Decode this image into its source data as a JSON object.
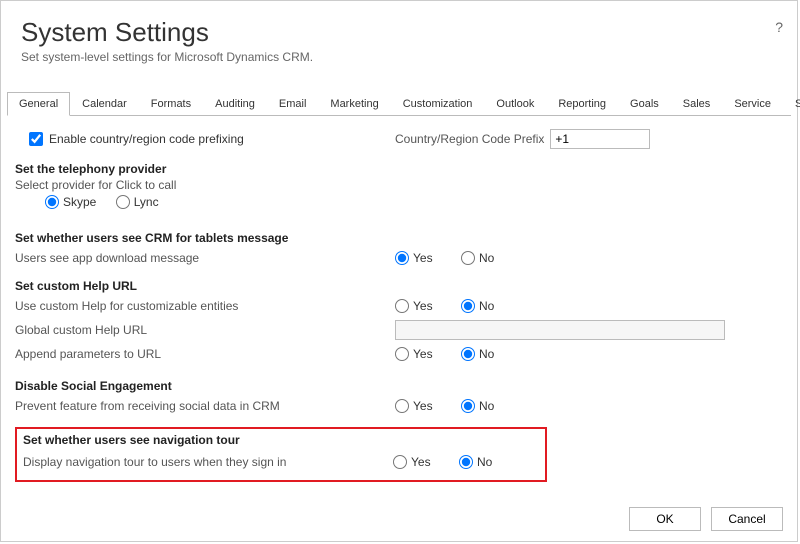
{
  "header": {
    "title": "System Settings",
    "subtitle": "Set system-level settings for Microsoft Dynamics CRM.",
    "help": "?"
  },
  "tabs": [
    "General",
    "Calendar",
    "Formats",
    "Auditing",
    "Email",
    "Marketing",
    "Customization",
    "Outlook",
    "Reporting",
    "Goals",
    "Sales",
    "Service",
    "Synchronization"
  ],
  "activeTab": "General",
  "enablePrefix": {
    "label": "Enable country/region code prefixing",
    "checked": true
  },
  "countryPrefix": {
    "label": "Country/Region Code Prefix",
    "value": "+1"
  },
  "yes": "Yes",
  "no": "No",
  "sections": {
    "telephony": {
      "title": "Set the telephony provider",
      "sub": "Select provider for Click to call",
      "options": [
        "Skype",
        "Lync"
      ],
      "selected": "Skype"
    },
    "tablets": {
      "title": "Set whether users see CRM for tablets message",
      "sub": "Users see app download message",
      "selected": "Yes"
    },
    "helpurl": {
      "title": "Set custom Help URL",
      "row1": "Use custom Help for customizable entities",
      "row1_selected": "No",
      "row2": "Global custom Help URL",
      "row3": "Append parameters to URL",
      "row3_selected": "No"
    },
    "social": {
      "title": "Disable Social Engagement",
      "sub": "Prevent feature from receiving social data in CRM",
      "selected": "No"
    },
    "navtour": {
      "title": "Set whether users see navigation tour",
      "sub": "Display navigation tour to users when they sign in",
      "selected": "No"
    }
  },
  "footer": {
    "ok": "OK",
    "cancel": "Cancel"
  }
}
